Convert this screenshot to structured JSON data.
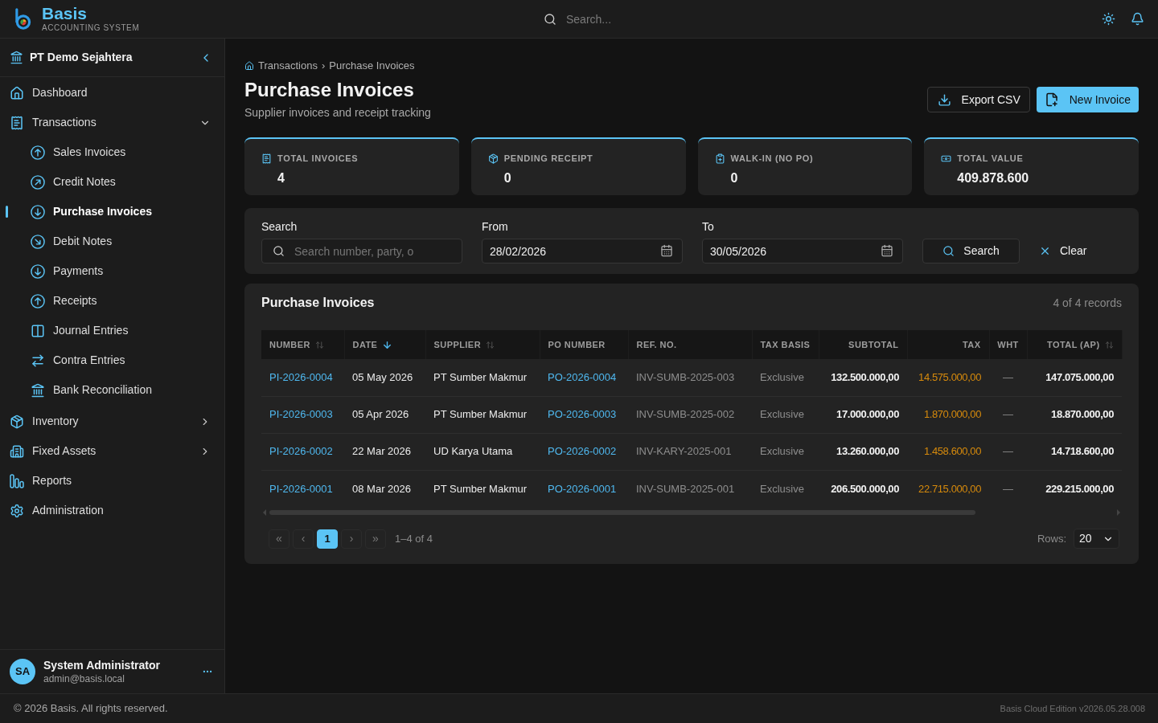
{
  "app": {
    "name": "Basis",
    "tagline": "ACCOUNTING SYSTEM"
  },
  "top_bar": {
    "search": {
      "placeholder": "Search..."
    }
  },
  "sidebar": {
    "company": "PT Demo Sejahtera",
    "items": [
      {
        "label": "Dashboard",
        "selected": false
      },
      {
        "label": "Transactions",
        "selected": false,
        "expanded": true,
        "children": [
          {
            "label": "Sales Invoices",
            "selected": false
          },
          {
            "label": "Credit Notes",
            "selected": false
          },
          {
            "label": "Purchase Invoices",
            "selected": true
          },
          {
            "label": "Debit Notes",
            "selected": false
          },
          {
            "label": "Payments",
            "selected": false
          },
          {
            "label": "Receipts",
            "selected": false
          },
          {
            "label": "Journal Entries",
            "selected": false
          },
          {
            "label": "Contra Entries",
            "selected": false
          },
          {
            "label": "Bank Reconciliation",
            "selected": false
          }
        ]
      },
      {
        "label": "Inventory",
        "selected": false,
        "expanded": false
      },
      {
        "label": "Fixed Assets",
        "selected": false,
        "expanded": false
      },
      {
        "label": "Reports",
        "selected": false
      },
      {
        "label": "Administration",
        "selected": false
      }
    ],
    "user": {
      "initials": "SA",
      "name": "System Administrator",
      "email": "admin@basis.local"
    }
  },
  "breadcrumb": {
    "items": [
      "Transactions",
      "Purchase Invoices"
    ],
    "separator": "›"
  },
  "page": {
    "title": "Purchase Invoices",
    "subtitle": "Supplier invoices and receipt tracking",
    "actions": [
      {
        "label": "Export CSV",
        "kind": "secondary"
      },
      {
        "label": "New Invoice",
        "kind": "primary"
      }
    ]
  },
  "stats": [
    {
      "label": "TOTAL INVOICES",
      "value": "4"
    },
    {
      "label": "PENDING RECEIPT",
      "value": "0"
    },
    {
      "label": "WALK-IN (NO PO)",
      "value": "0"
    },
    {
      "label": "TOTAL VALUE",
      "value": "409.878.600"
    }
  ],
  "filters": {
    "search": {
      "label": "Search",
      "placeholder": "Search number, party, o"
    },
    "from": {
      "label": "From",
      "value": "28/02/2026"
    },
    "to": {
      "label": "To",
      "value": "30/05/2026"
    },
    "buttons": [
      {
        "label": "Search",
        "kind": "search"
      },
      {
        "label": "Clear",
        "kind": "clear"
      }
    ]
  },
  "table": {
    "title": "Purchase Invoices",
    "count": "4 of 4 records",
    "columns": [
      {
        "label": "NUMBER",
        "kind": "link",
        "sortable": true,
        "sorted": false
      },
      {
        "label": "DATE",
        "kind": "strong",
        "sortable": true,
        "sorted": true
      },
      {
        "label": "SUPPLIER",
        "kind": "strong",
        "sortable": true,
        "sorted": false
      },
      {
        "label": "PO NUMBER",
        "kind": "link",
        "sortable": false,
        "sorted": false
      },
      {
        "label": "REF. NO.",
        "kind": "muted",
        "sortable": false,
        "sorted": false
      },
      {
        "label": "TAX BASIS",
        "kind": "muted",
        "sortable": false,
        "sorted": false
      },
      {
        "label": "SUBTOTAL",
        "kind": "amount",
        "sortable": false,
        "sorted": false
      },
      {
        "label": "TAX",
        "kind": "tax",
        "sortable": false,
        "sorted": false
      },
      {
        "label": "WHT",
        "kind": "dash",
        "sortable": false,
        "sorted": false
      },
      {
        "label": "TOTAL (AP)",
        "kind": "amount",
        "sortable": true,
        "sorted": false
      }
    ],
    "rows": [
      [
        "PI-2026-0004",
        "05 May 2026",
        "PT Sumber Makmur",
        "PO-2026-0004",
        "INV-SUMB-2025-003",
        "Exclusive",
        "132.500.000,00",
        "14.575.000,00",
        "—",
        "147.075.000,00"
      ],
      [
        "PI-2026-0003",
        "05 Apr 2026",
        "PT Sumber Makmur",
        "PO-2026-0003",
        "INV-SUMB-2025-002",
        "Exclusive",
        "17.000.000,00",
        "1.870.000,00",
        "—",
        "18.870.000,00"
      ],
      [
        "PI-2026-0002",
        "22 Mar 2026",
        "UD Karya Utama",
        "PO-2026-0002",
        "INV-KARY-2025-001",
        "Exclusive",
        "13.260.000,00",
        "1.458.600,00",
        "—",
        "14.718.600,00"
      ],
      [
        "PI-2026-0001",
        "08 Mar 2026",
        "PT Sumber Makmur",
        "PO-2026-0001",
        "INV-SUMB-2025-001",
        "Exclusive",
        "206.500.000,00",
        "22.715.000,00",
        "—",
        "229.215.000,00"
      ]
    ]
  },
  "pagination": {
    "first": "«",
    "prev": "‹",
    "pages": [
      {
        "label": "1",
        "selected": true
      }
    ],
    "next": "›",
    "last": "»",
    "range": "1–4 of 4",
    "rows_label": "Rows:",
    "rows_value": "20"
  },
  "footer": {
    "copyright": "© 2026 Basis. All rights reserved.",
    "version": "Basis Cloud Edition v2026.05.28.008"
  }
}
